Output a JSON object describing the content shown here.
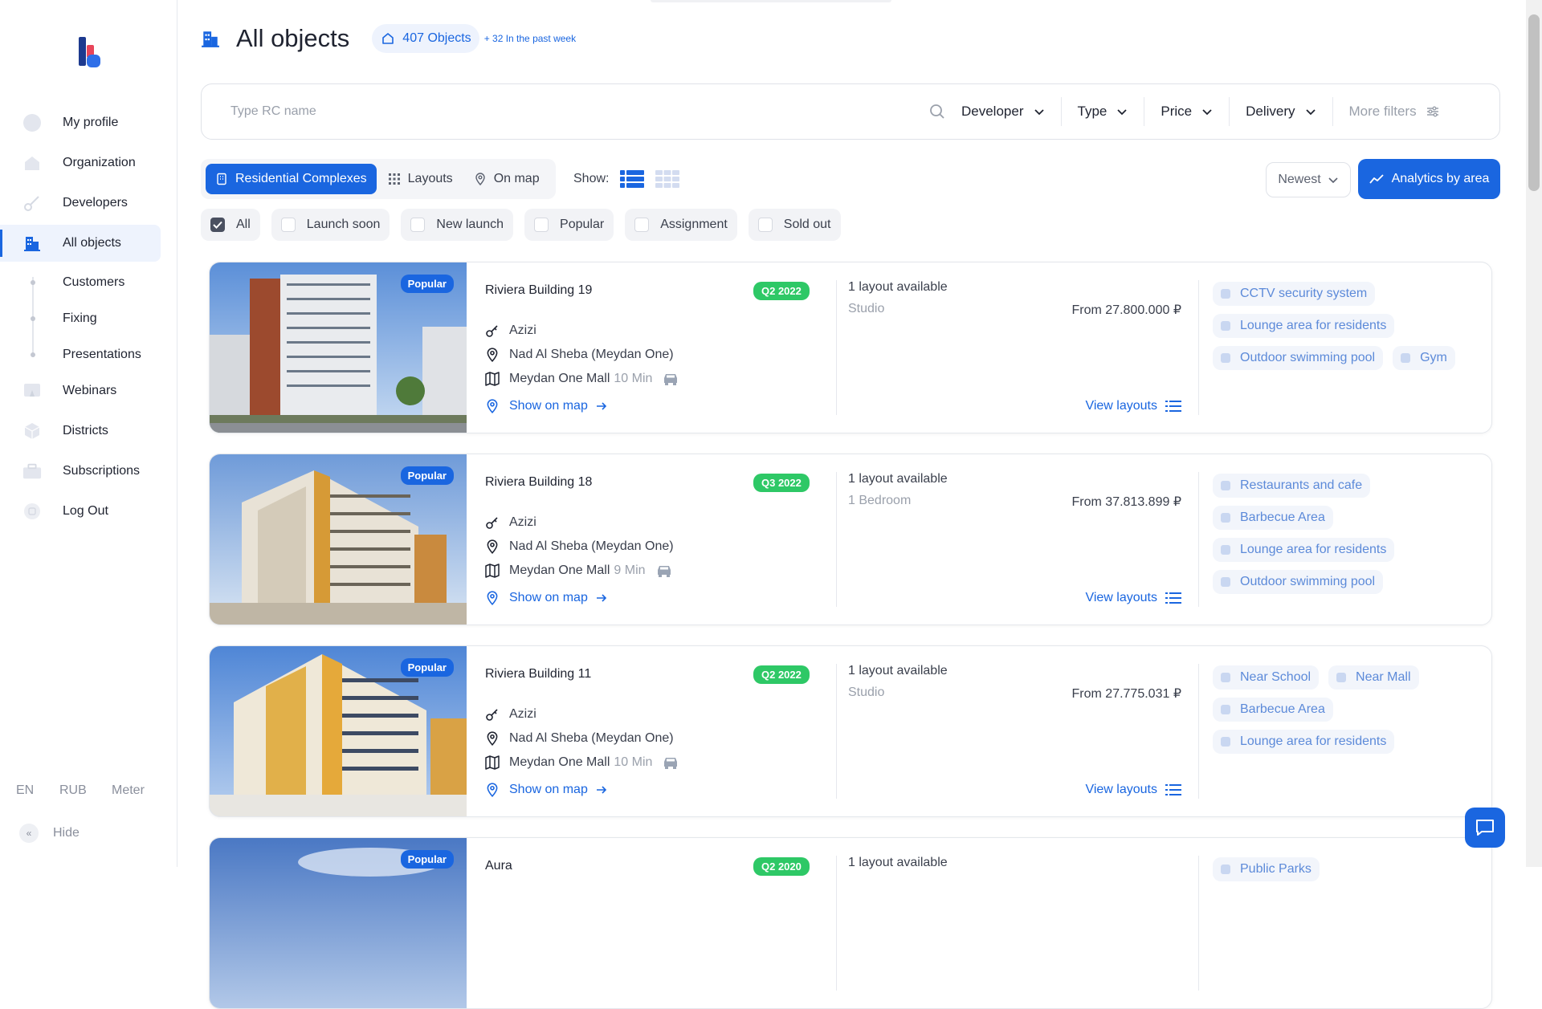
{
  "sidebar": {
    "items": [
      {
        "label": "My profile",
        "icon": "user-icon"
      },
      {
        "label": "Organization",
        "icon": "building-icon"
      },
      {
        "label": "Developers",
        "icon": "key-icon"
      },
      {
        "label": "All objects",
        "icon": "buildings-icon",
        "active": true
      }
    ],
    "sub_items": [
      {
        "label": "Customers"
      },
      {
        "label": "Fixing"
      },
      {
        "label": "Presentations"
      }
    ],
    "items_bottom": [
      {
        "label": "Webinars",
        "icon": "presentation-icon"
      },
      {
        "label": "Districts",
        "icon": "cube-icon"
      },
      {
        "label": "Subscriptions",
        "icon": "briefcase-icon"
      },
      {
        "label": "Log Out",
        "icon": "logout-icon"
      }
    ],
    "footer": {
      "lang": "EN",
      "currency": "RUB",
      "units": "Meter",
      "hide_label": "Hide"
    }
  },
  "header": {
    "title": "All objects",
    "count": "407 Objects",
    "week": "+ 32 In the past week"
  },
  "search": {
    "placeholder": "Type RC name",
    "filters": [
      "Developer",
      "Type",
      "Price",
      "Delivery"
    ],
    "more": "More filters"
  },
  "tabs": [
    {
      "label": "Residential Complexes",
      "active": true
    },
    {
      "label": "Layouts"
    },
    {
      "label": "On map"
    }
  ],
  "show_label": "Show:",
  "sort": "Newest",
  "analytics": "Analytics by area",
  "chips": [
    {
      "label": "All",
      "checked": true
    },
    {
      "label": "Launch soon"
    },
    {
      "label": "New launch"
    },
    {
      "label": "Popular"
    },
    {
      "label": "Assignment"
    },
    {
      "label": "Sold out"
    }
  ],
  "cards": [
    {
      "badge": "Popular",
      "title": "Riviera Building 19",
      "quarter": "Q2 2022",
      "developer": "Azizi",
      "location": "Nad Al Sheba (Meydan One)",
      "landmark": "Meydan One Mall",
      "minutes": "10 Min",
      "map_link": "Show on map",
      "layouts": "1 layout available",
      "layout_type": "Studio",
      "price": "From 27.800.000 ₽",
      "view": "View layouts",
      "amenities": [
        "CCTV security system",
        "Lounge area for residents",
        "Outdoor swimming pool",
        "Gym"
      ]
    },
    {
      "badge": "Popular",
      "title": "Riviera Building 18",
      "quarter": "Q3 2022",
      "developer": "Azizi",
      "location": "Nad Al Sheba (Meydan One)",
      "landmark": "Meydan One Mall",
      "minutes": "9 Min",
      "map_link": "Show on map",
      "layouts": "1 layout available",
      "layout_type": "1 Bedroom",
      "price": "From 37.813.899 ₽",
      "view": "View layouts",
      "amenities": [
        "Restaurants and cafe",
        "Barbecue Area",
        "Lounge area for residents",
        "Outdoor swimming pool"
      ]
    },
    {
      "badge": "Popular",
      "title": "Riviera Building 11",
      "quarter": "Q2 2022",
      "developer": "Azizi",
      "location": "Nad Al Sheba (Meydan One)",
      "landmark": "Meydan One Mall",
      "minutes": "10 Min",
      "map_link": "Show on map",
      "layouts": "1 layout available",
      "layout_type": "Studio",
      "price": "From 27.775.031 ₽",
      "view": "View layouts",
      "amenities": [
        "Near School",
        "Near Mall",
        "Barbecue Area",
        "Lounge area for residents"
      ]
    },
    {
      "badge": "Popular",
      "title": "Aura",
      "quarter": "Q2 2020",
      "layouts": "1 layout available",
      "amenities": [
        "Public Parks"
      ]
    }
  ],
  "colors": {
    "accent": "#1a66e0",
    "green": "#2ec866"
  }
}
